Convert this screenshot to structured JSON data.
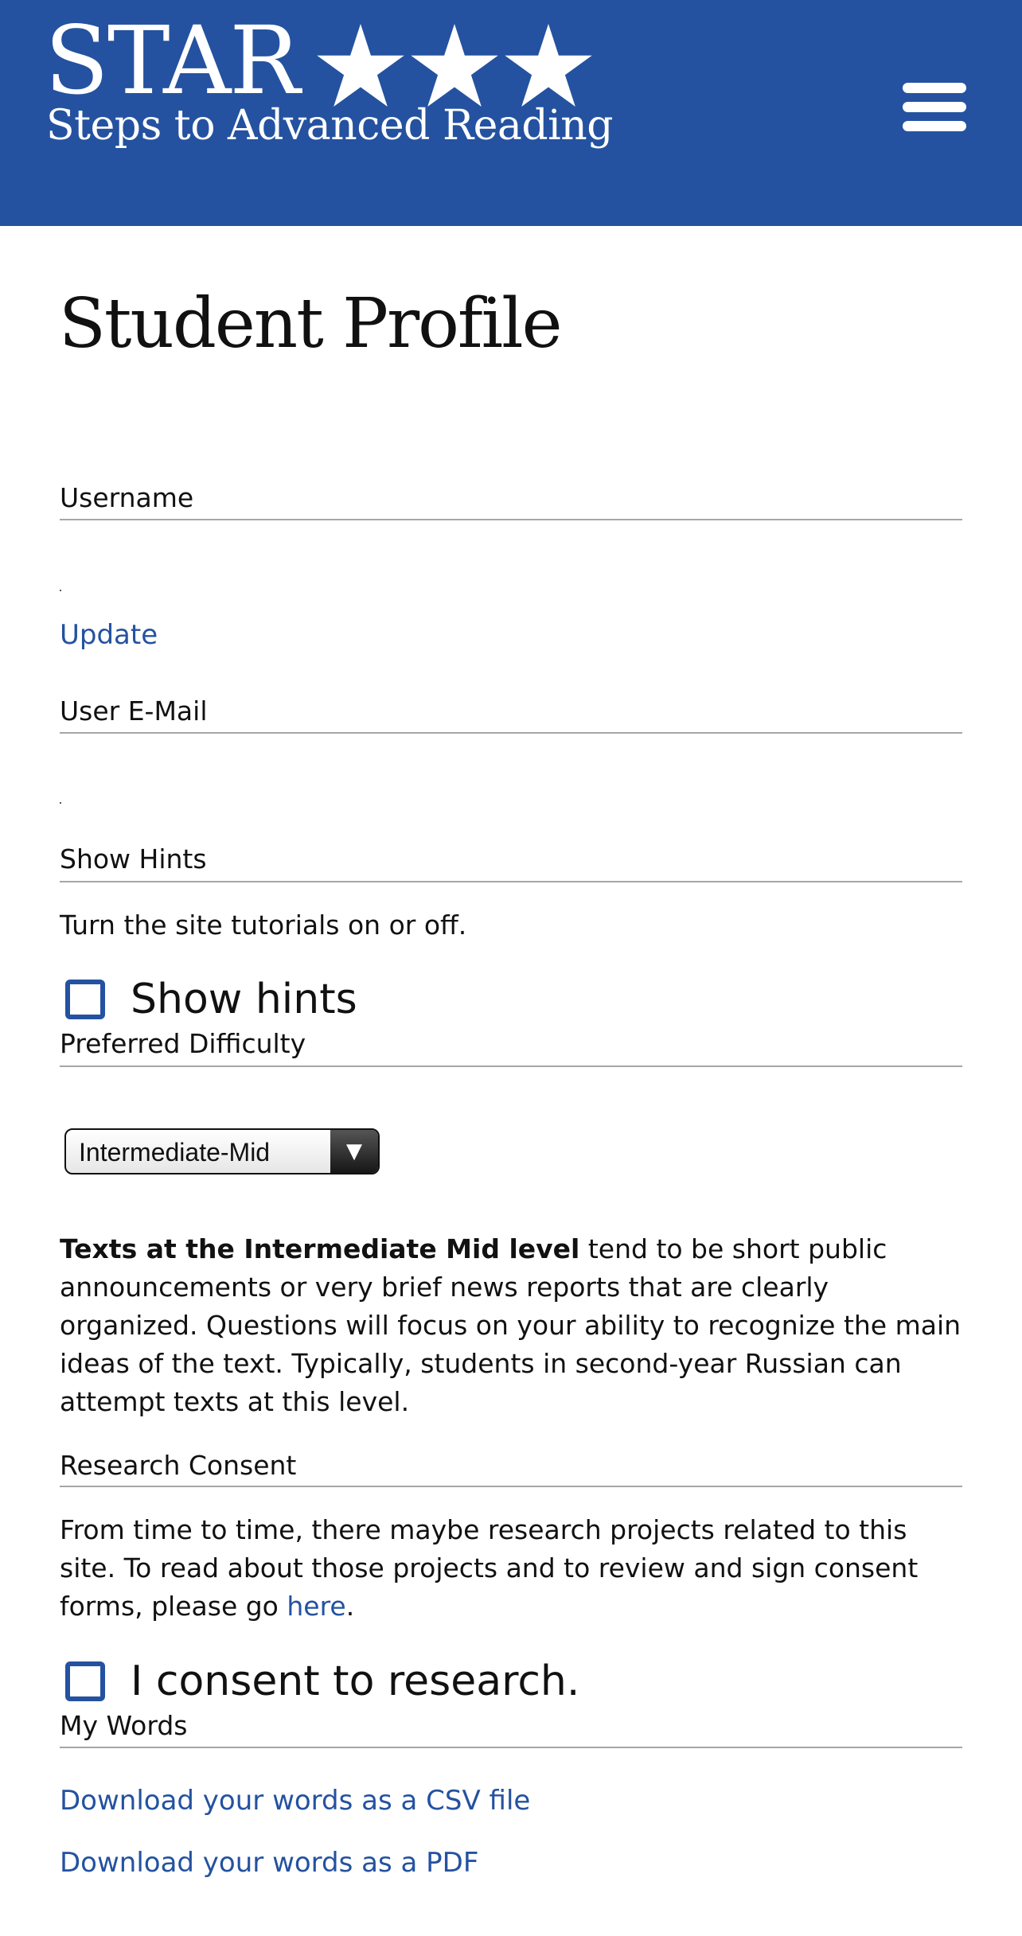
{
  "header": {
    "logo_title": "STAR",
    "logo_subtitle": "Steps to Advanced Reading",
    "menu_icon": "hamburger-menu-icon",
    "background_color": "#2452a0"
  },
  "page_title": "Student Profile",
  "username": {
    "label": "Username",
    "update_link": "Update"
  },
  "email": {
    "label": "User E-Mail"
  },
  "hints": {
    "label": "Show Hints",
    "description": "Turn the site tutorials on or off.",
    "checkbox_label": "Show hints",
    "checked": false
  },
  "difficulty": {
    "label": "Preferred Difficulty",
    "selected": "Intermediate-Mid",
    "description_bold": "Texts at the Intermediate Mid level",
    "description_rest": " tend to be short public announcements or very brief news reports that are clearly organized. Questions will focus on your ability to recognize the main ideas of the text. Typically, students in second-year Russian can attempt texts at this level."
  },
  "research": {
    "label": "Research Consent",
    "description_before": "From time to time, there maybe research projects related to this site. To read about those projects and to review and sign consent forms, please go ",
    "link_text": "here",
    "description_after": ".",
    "checkbox_label": "I consent to research.",
    "checked": false
  },
  "words": {
    "label": "My Words",
    "csv_link": "Download your words as a CSV file",
    "pdf_link": "Download your words as a PDF"
  },
  "colors": {
    "accent": "#2452a0",
    "text": "#111111",
    "rule": "#a6a6a6"
  }
}
